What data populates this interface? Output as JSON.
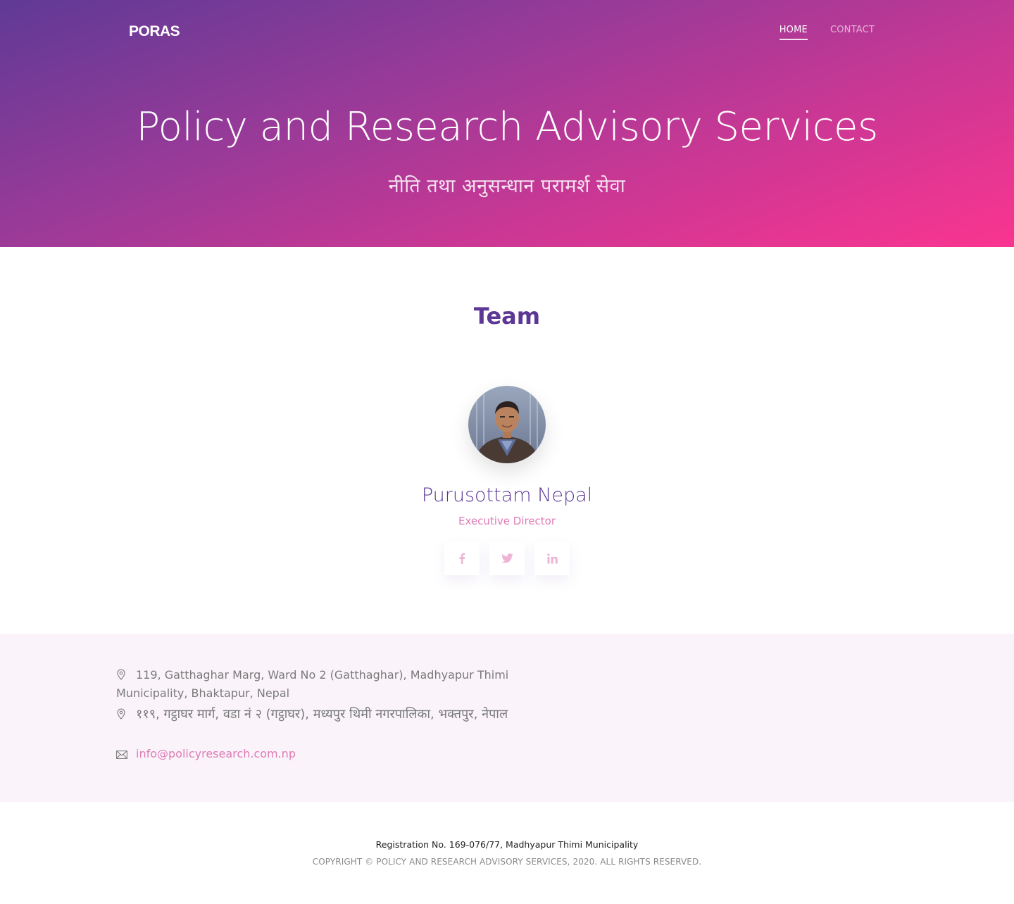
{
  "header": {
    "logo": "PORAS",
    "nav": [
      {
        "label": "HOME",
        "active": true
      },
      {
        "label": "CONTACT",
        "active": false
      }
    ]
  },
  "hero": {
    "title": "Policy and Research Advisory Services",
    "subtitle_np": "नीति तथा अनुसन्धान परामर्श सेवा"
  },
  "team": {
    "title": "Team",
    "members": [
      {
        "name": "Purusottam Nepal",
        "role": "Executive Director",
        "socials": [
          {
            "icon": "facebook-icon",
            "glyph": "f"
          },
          {
            "icon": "twitter-icon",
            "glyph": "t"
          },
          {
            "icon": "linkedin-icon",
            "glyph": "in"
          }
        ]
      }
    ]
  },
  "contact": {
    "address_en": "119, Gatthaghar Marg, Ward No 2 (Gatthaghar), Madhyapur Thimi Municipality, Bhaktapur, Nepal",
    "address_np": "११९, गट्ठाघर मार्ग, वडा नं २ (गट्ठाघर), मध्यपुर थिमी नगरपालिका, भक्तपुर, नेपाल",
    "email": "info@policyresearch.com.np"
  },
  "footer": {
    "registration": "Registration No. 169-076/77, Madhyapur Thimi Municipality",
    "copyright": "COPYRIGHT © POLICY AND RESEARCH ADVISORY SERVICES, 2020. ALL RIGHTS RESERVED."
  },
  "colors": {
    "brand_purple": "#5c3795",
    "brand_pink": "#fa3590",
    "accent_pink": "#e07bb6"
  }
}
